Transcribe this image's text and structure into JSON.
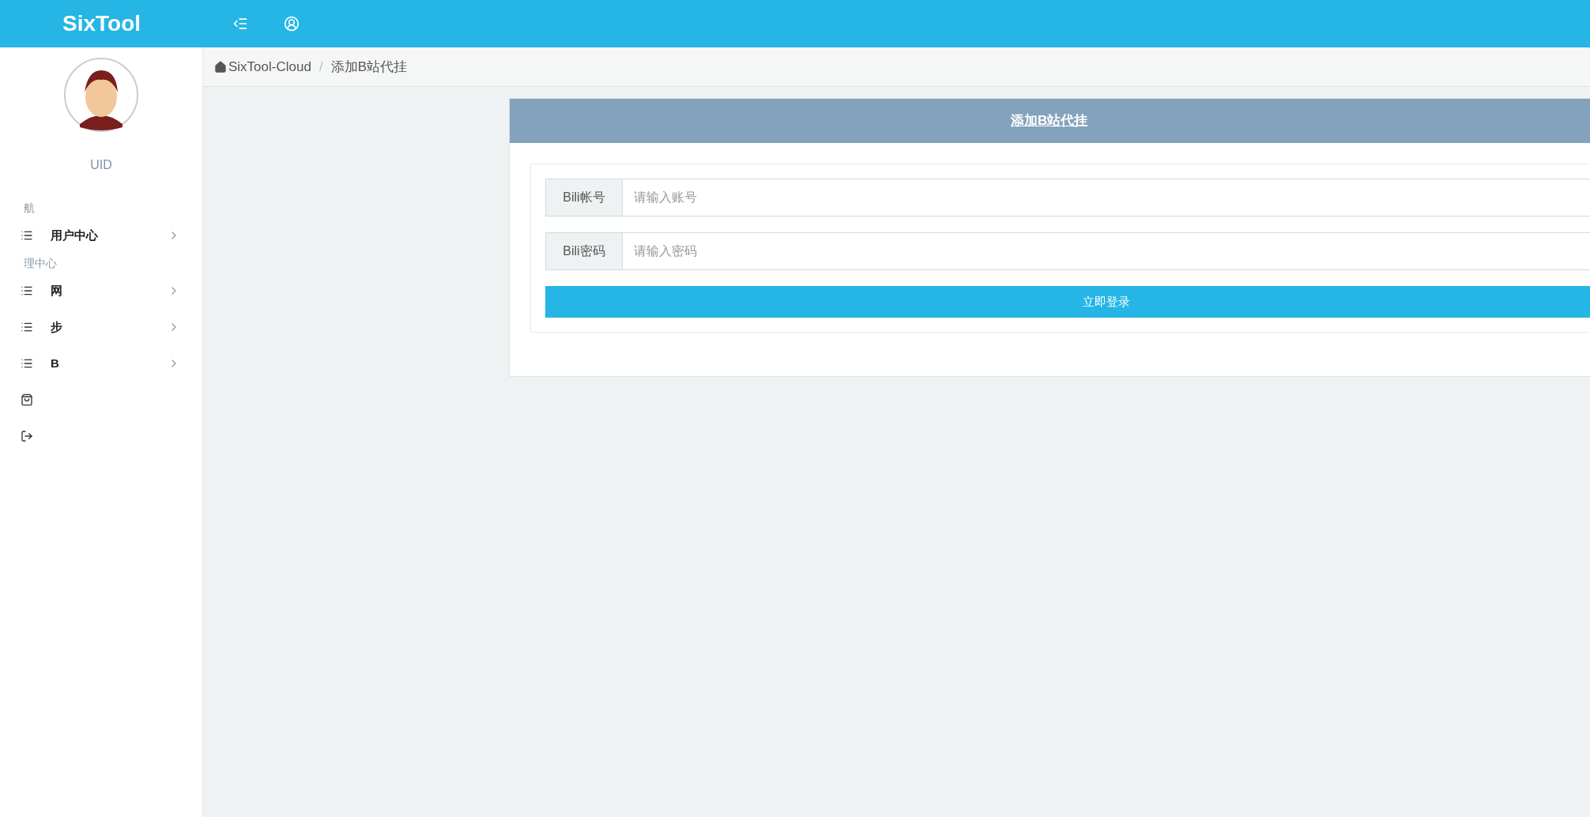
{
  "header": {
    "logo": "SixTool"
  },
  "user": {
    "uid_label": "UID"
  },
  "sidebar": {
    "items": [
      {
        "kind": "heading",
        "label": "航"
      },
      {
        "kind": "menu",
        "label": "用户中心",
        "expandable": true
      },
      {
        "kind": "heading",
        "label": "理中心"
      },
      {
        "kind": "menu",
        "label": "网",
        "expandable": true
      },
      {
        "kind": "menu",
        "label": "步",
        "expandable": true
      },
      {
        "kind": "menu",
        "label": "B",
        "expandable": true
      },
      {
        "kind": "shop",
        "expandable": false
      },
      {
        "kind": "logout",
        "expandable": false
      }
    ]
  },
  "breadcrumb": {
    "root": "SixTool-Cloud",
    "separator": "/",
    "current": "添加B站代挂"
  },
  "card": {
    "title": "添加B站代挂",
    "fields": [
      {
        "label": "Bili帐号",
        "placeholder": "请输入账号"
      },
      {
        "label": "Bili密码",
        "placeholder": "请输入密码"
      }
    ],
    "submit": "立即登录"
  }
}
